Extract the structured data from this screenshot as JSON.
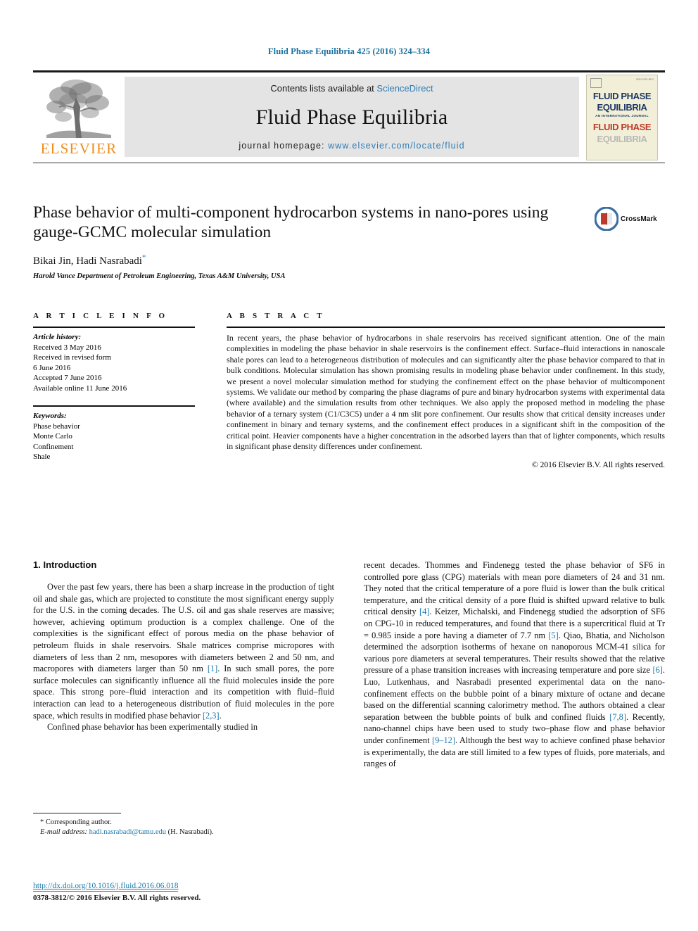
{
  "running_head": "Fluid Phase Equilibria 425 (2016) 324–334",
  "masthead": {
    "publisher_logo_word": "ELSEVIER",
    "contents_prefix": "Contents lists available at ",
    "contents_link": "ScienceDirect",
    "journal_title": "Fluid Phase Equilibria",
    "homepage_prefix": "journal homepage: ",
    "homepage_url": "www.elsevier.com/locate/fluid",
    "cover": {
      "line1": "FLUID PHASE",
      "line2": "EQUILIBRIA",
      "line3": "AN INTERNATIONAL JOURNAL",
      "line4": "FLUID PHASE",
      "line5": "EQUILIBRIA",
      "corner_note": "ISSN 0378-3812"
    }
  },
  "article": {
    "title": "Phase behavior of multi-component hydrocarbon systems in nano-pores using gauge-GCMC molecular simulation",
    "authors": "Bikai Jin, Hadi Nasrabadi",
    "corresponding_marker": "*",
    "affiliation": "Harold Vance Department of Petroleum Engineering, Texas A&M University, USA",
    "crossmark_label": "CrossMark"
  },
  "article_info": {
    "heading": "A R T I C L E   I N F O",
    "history_label": "Article history:",
    "history": [
      "Received 3 May 2016",
      "Received in revised form",
      "6 June 2016",
      "Accepted 7 June 2016",
      "Available online 11 June 2016"
    ],
    "keywords_label": "Keywords:",
    "keywords": [
      "Phase behavior",
      "Monte Carlo",
      "Confinement",
      "Shale"
    ]
  },
  "abstract": {
    "heading": "A B S T R A C T",
    "text": "In recent years, the phase behavior of hydrocarbons in shale reservoirs has received significant attention. One of the main complexities in modeling the phase behavior in shale reservoirs is the confinement effect. Surface–fluid interactions in nanoscale shale pores can lead to a heterogeneous distribution of molecules and can significantly alter the phase behavior compared to that in bulk conditions. Molecular simulation has shown promising results in modeling phase behavior under confinement. In this study, we present a novel molecular simulation method for studying the confinement effect on the phase behavior of multicomponent systems. We validate our method by comparing the phase diagrams of pure and binary hydrocarbon systems with experimental data (where available) and the simulation results from other techniques. We also apply the proposed method in modeling the phase behavior of a ternary system (C1/C3C5) under a 4 nm slit pore confinement. Our results show that critical density increases under confinement in binary and ternary systems, and the confinement effect produces in a significant shift in the composition of the critical point. Heavier components have a higher concentration in the adsorbed layers than that of lighter components, which results in significant phase density differences under confinement.",
    "copyright": "© 2016 Elsevier B.V. All rights reserved."
  },
  "body": {
    "section_number_title": "1.  Introduction",
    "left_paragraph_1": "Over the past few years, there has been a sharp increase in the production of tight oil and shale gas, which are projected to constitute the most significant energy supply for the U.S. in the coming decades. The U.S. oil and gas shale reserves are massive; however, achieving optimum production is a complex challenge. One of the complexities is the significant effect of porous media on the phase behavior of petroleum fluids in shale reservoirs. Shale matrices comprise micropores with diameters of less than 2 nm, mesopores with diameters between 2 and 50 nm, and macropores with diameters larger than 50 nm ",
    "left_ref_1": "[1]",
    "left_paragraph_1b": ". In such small pores, the pore surface molecules can significantly influence all the fluid molecules inside the pore space. This strong pore–fluid interaction and its competition with fluid–fluid interaction can lead to a heterogeneous distribution of fluid molecules in the pore space, which results in modified phase behavior ",
    "left_ref_2": "[2,3]",
    "left_paragraph_1c": ".",
    "left_paragraph_2": "Confined phase behavior has been experimentally studied in",
    "right_paragraph_a": "recent decades. Thommes and Findenegg tested the phase behavior of SF6 in controlled pore glass (CPG) materials with mean pore diameters of 24 and 31 nm. They noted that the critical temperature of a pore fluid is lower than the bulk critical temperature, and the critical density of a pore fluid is shifted upward relative to bulk critical density ",
    "right_ref_4": "[4]",
    "right_paragraph_b": ". Keizer, Michalski, and Findenegg studied the adsorption of SF6 on CPG-10 in reduced temperatures, and found that there is a supercritical fluid at Tr = 0.985 inside a pore having a diameter of 7.7 nm ",
    "right_ref_5": "[5]",
    "right_paragraph_c": ". Qiao, Bhatia, and Nicholson determined the adsorption isotherms of hexane on nanoporous MCM-41 silica for various pore diameters at several temperatures. Their results showed that the relative pressure of a phase transition increases with increasing temperature and pore size ",
    "right_ref_6": "[6]",
    "right_paragraph_d": ". Luo, Lutkenhaus, and Nasrabadi presented experimental data on the nano-confinement effects on the bubble point of a binary mixture of octane and decane based on the differential scanning calorimetry method. The authors obtained a clear separation between the bubble points of bulk and confined fluids ",
    "right_ref_7": "[7,8]",
    "right_paragraph_e": ". Recently, nano-channel chips have been used to study two–phase flow and phase behavior under confinement ",
    "right_ref_9": "[9–12]",
    "right_paragraph_f": ". Although the best way to achieve confined phase behavior is experimentally, the data are still limited to a few types of fluids, pore materials, and ranges of"
  },
  "footer": {
    "corresponding_marker": "*",
    "corresponding_label": "Corresponding author.",
    "email_label": "E-mail address:",
    "email": "hadi.nasrabadi@tamu.edu",
    "email_suffix": "(H. Nasrabadi).",
    "doi": "http://dx.doi.org/10.1016/j.fluid.2016.06.018",
    "issn_copyright": "0378-3812/© 2016 Elsevier B.V. All rights reserved."
  },
  "colors": {
    "link_blue": "#1b7aad",
    "header_blue": "#1b6f9c",
    "elsevier_orange": "#F08C1A"
  }
}
